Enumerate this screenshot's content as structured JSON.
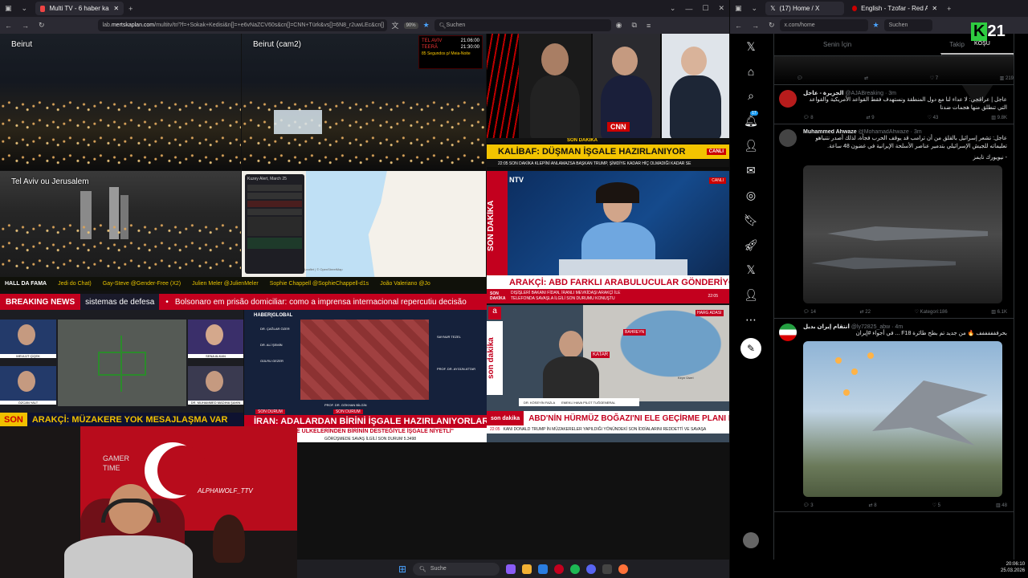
{
  "left_browser": {
    "tab_title": "Multi TV - 6 haber kanalını",
    "url_prefix": "lab.",
    "url_domain": "mertskaplan.com",
    "url_rest": "/multitv/tr/?f=+Sokak+Kedisi&n[]=+e6vNaZCV60s&cn[]=CNN+Türk&vs[]=6N8_r2uwLEc&cn[]",
    "zoom": "90%",
    "search_placeholder": "Suchen"
  },
  "cams": {
    "beirut": "Beirut",
    "beirut2": "Beirut (cam2)",
    "telaviv": "Tel Aviv ou Jerusalem"
  },
  "alert_box": {
    "line1_city": "TEL AVIV",
    "line1_time": "21:06:00",
    "line2_city": "TEERÃ",
    "line2_time": "21:30:00",
    "countdown": "85 Segundos p/ Meia-Noite"
  },
  "ticker": [
    "HALL DA FAMA",
    "Jedi do Chat)",
    "Gay-Steve @Gender-Free (X2)",
    "Julien Meler @JulienMeler",
    "Sophie Chappell @SophieChappell-d1s",
    "João Valeriano @Jo"
  ],
  "breaking": {
    "label": "BREAKING NEWS",
    "text1": "sistemas de defesa",
    "text2": "Bolsonaro em prisão domiciliar: como a imprensa internacional repercutiu decisão"
  },
  "cnn_turk": {
    "headline": "KALİBAF: DÜŞMAN İŞGALE HAZIRLANIYOR",
    "tag": "SON DAKİKA",
    "sub": "22:05  SON DAKİKA  KLEPİNİ ANLAMAZSA BAŞKAN TRUMP, ŞİMDİYE KADAR HİÇ OLMADIĞI KADAR SE",
    "logo": "CNN",
    "live": "CANLI"
  },
  "ntv": {
    "logo": "NTV",
    "side": "SON DAKİKA",
    "headline": "ARAKÇİ: ABD FARKLI ARABULUCULAR GÖNDERİYOR",
    "sub1": "DIŞİŞLERİ BAKANI FİDAN, İRANLI MEVKİDAŞI ARAKÇİ İLE",
    "sub2": "TELEFONDA SAVAŞLA İLGİLİ SON DURUMU KONUŞTU",
    "time": "22:05",
    "tag": "SON DAKİKA",
    "live": "CANLI"
  },
  "halk": {
    "headline": "ARAKÇİ: MÜZAKERE YOK MESAJLAŞMA VAR",
    "tag": "SON",
    "live": "CANLI",
    "name1": "MEVLÜT ÇİÇEK",
    "name2": "SENA ALKAN",
    "name3": "ÖZCAN YALT",
    "name4": "DR. MUHAMMED MADIHA ŞAHİN"
  },
  "haberturk": {
    "logo1": "HABER",
    "logo2": "TÜRK",
    "global": "HABER|GLOBAL",
    "headline": "İRAN: ADALARDAN BİRİNİ İŞGALE HAZIRLANIYORLAR",
    "sub": "ÇE ÜLKELERİNDEN BİRİNİN DESTEĞİYLE İŞGALE NİYETLİ\"",
    "tag1": "SON DURUM",
    "tag2": "SON DURUM",
    "ticker": "GÖRÜŞMEDE SAVAŞ İLGİLİ SON DURUM  5.3498",
    "guest1": "DR. ÇAĞLAR ÖZER",
    "guest2": "DR. ALİ ŞEMİN",
    "guest3": "GÜLRU GEZER",
    "guest4": "PROF. DR. GÖKHAN BİLGİN",
    "guest5": "SAYNUR TEZEL",
    "guest6": "PROF. DR. AYGÜN ATTAR"
  },
  "a_haber": {
    "logo": "a",
    "side": "son dakika",
    "headline": "ABD'NİN HÜRMÜZ BOĞAZI'NI ELE GEÇİRME PLANI NE?",
    "sub": "KANI DONALD TRUMP İN MÜZAKERELER YAPILDIĞI YÖNÜNDEKİ SON İDDİALARINI REDDETTİ VE SAVAŞA",
    "map1": "HARG ADASI",
    "map2": "BAHREYN",
    "map3": "KATAR",
    "map4": "Keyn Üseri",
    "name": "DR. KÖSEYİN FAZLA",
    "role": "EMEKLİ HAVA PİLOT TUĞGENERAL",
    "time": "22:05"
  },
  "map_panel": {
    "title": "Kuzey Alert, March 25",
    "tab": "Leaflet | © OpenStreetMap"
  },
  "streamer": {
    "sign": "GAMER TIME",
    "name": "ALPHAWOLF_TTV"
  },
  "taskbar": {
    "search": "Suche"
  },
  "right_browser": {
    "tab1": "(17) Home / X",
    "tab2": "English - Tzofar - Red Alert",
    "url": "x.com/home",
    "search": "Suchen",
    "logo": "21",
    "logo_sub": "KOŞU",
    "tabs": {
      "for_you": "Senin İçin",
      "following": "Takip"
    },
    "badge": "17"
  },
  "posts": [
    {
      "name": "الجزيرة - عاجل",
      "handle": "@AJABreaking · 3m",
      "text": "عاجل | عراقجي: لا عداء لنا مع دول المنطقة ونستهدف فقط القواعد الأمريكية والقواعد التي تنطلق منها هجمات ضدنا",
      "acts": [
        "8",
        "9",
        "43",
        "9.8K"
      ]
    },
    {
      "name": "Muhammed Ahwaze",
      "handle": "@MohamadAhwaze · 3m",
      "text": "عاجل: تشعر إسرائيل بالقلق من أن ترامب قد يوقف الحرب فجأة، لذلك أصدر نتنياهو تعليماته للجيش الإسرائيلي بتدمير عناصر الأسلحة الإيرانية في غضون 48 ساعة.",
      "note": "- نيويورك تايمز",
      "acts": [
        "14",
        "22",
        "Kategori:186",
        "6.1K"
      ]
    },
    {
      "name": "أنتقام إيران بديل",
      "handle": "@ly72825_abw · 4m",
      "text": "بحرففففففف 🔥 من جديد تم بطح طائرة F18 ... في أجواء #إيران",
      "acts": [
        "3",
        "8",
        "5",
        "48"
      ]
    }
  ],
  "top_acts": [
    "",
    "7",
    "7",
    "219"
  ],
  "clock": {
    "time": "20:06:10",
    "date": "25.03.2026"
  }
}
